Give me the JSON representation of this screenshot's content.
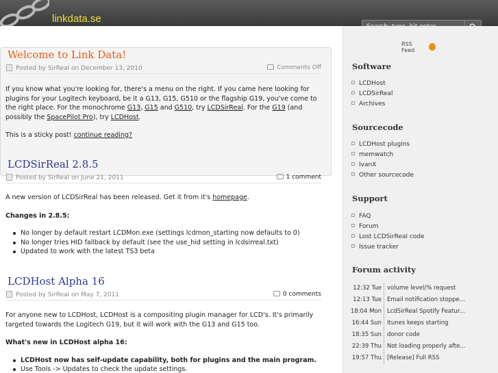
{
  "header": {
    "site_title": "linkdata.se",
    "search_placeholder": "Search: type, hit enter",
    "logo_icon": "chain-icon",
    "search_icon": "search-icon"
  },
  "posts": [
    {
      "title": "Welcome to Link Data!",
      "meta": "Posted by SirReal on December 13, 2010",
      "comments": "Comments Off",
      "paragraphs": {
        "p1_a": "If you know what you're looking for, there's a menu on the right. If you came here looking for plugins for your Logitech keyboard, be it a G13, G15, G510 or the flagship G19, you've come to the right place. For the monochrome ",
        "g13": "G13",
        "sep1": ", ",
        "g15": "G15",
        "and": " and ",
        "g510": "G510",
        "try1": ", try ",
        "lcdsirreal": "LCDSirReal",
        "for_the": ". For the ",
        "g19": "G19",
        "and_possibly": " (and possibly the ",
        "spacepilot": "SpacePilot Pro",
        "try2": "), try ",
        "lcdhost": "LCDHost",
        "dot": ".",
        "p2_a": "This is a sticky post! ",
        "continue": "continue reading?"
      }
    },
    {
      "title": "LCDSirReal 2.8.5",
      "meta": "Posted by SirReal on June 21, 2011",
      "comments": "1 comment",
      "intro_a": "A new version of LCDSirReal has been released. Get it from it's ",
      "intro_link": "homepage",
      "intro_b": ".",
      "changes_heading": "Changes in 2.8.5:",
      "bullets": [
        "No longer by default restart LCDMon.exe (settings lcdmon_starting now defaults to 0)",
        "No longer tries HID fallback by default (see the use_hid setting in lcdsirreal.txt)",
        "Updated to work with the latest TS3 beta"
      ]
    },
    {
      "title": "LCDHost Alpha 16",
      "meta": "Posted by SirReal on May 7, 2011",
      "comments": "0 comments",
      "intro": "For anyone new to LCDHost, LCDHost is a compositing plugin manager for LCD's. It's primarily targeted towards the Logitech G19, but it will work with the G13 and G15 too.",
      "whats_new": "What's new in LCDHost alpha 16:",
      "bullets": [
        "LCDHost now has self-update capability, both for plugins and the main program.",
        "Use Tools -> Updates to check the update settings."
      ]
    }
  ],
  "sidebar": {
    "rss_label": "RSS Feed",
    "rss_icon": "rss-icon",
    "software_heading": "Software",
    "software": [
      "LCDHost",
      "LCDSirReal",
      "Archives"
    ],
    "sourcecode_heading": "Sourcecode",
    "sourcecode": [
      "LCDHost plugins",
      "memwatch",
      "IvanX",
      "Other sourcecode"
    ],
    "support_heading": "Support",
    "support": [
      "FAQ",
      "Forum",
      "Lost LCDSirReal code",
      "Issue tracker"
    ],
    "activity_heading": "Forum activity",
    "activity": [
      {
        "time": "12:32 Tue",
        "subject": "volume level/% request"
      },
      {
        "time": "12:13 Tue",
        "subject": "Email notification stoppe..."
      },
      {
        "time": "18:04 Mon",
        "subject": "LcdSirReal Spotify Featur..."
      },
      {
        "time": "16:44 Sun",
        "subject": "Itunes keeps starting"
      },
      {
        "time": "18:35 Sun",
        "subject": "donor code"
      },
      {
        "time": "22:39 Thu",
        "subject": "Not loading properly afte..."
      },
      {
        "time": "19:57 Thu",
        "subject": "[Release] Full RSS"
      }
    ]
  }
}
